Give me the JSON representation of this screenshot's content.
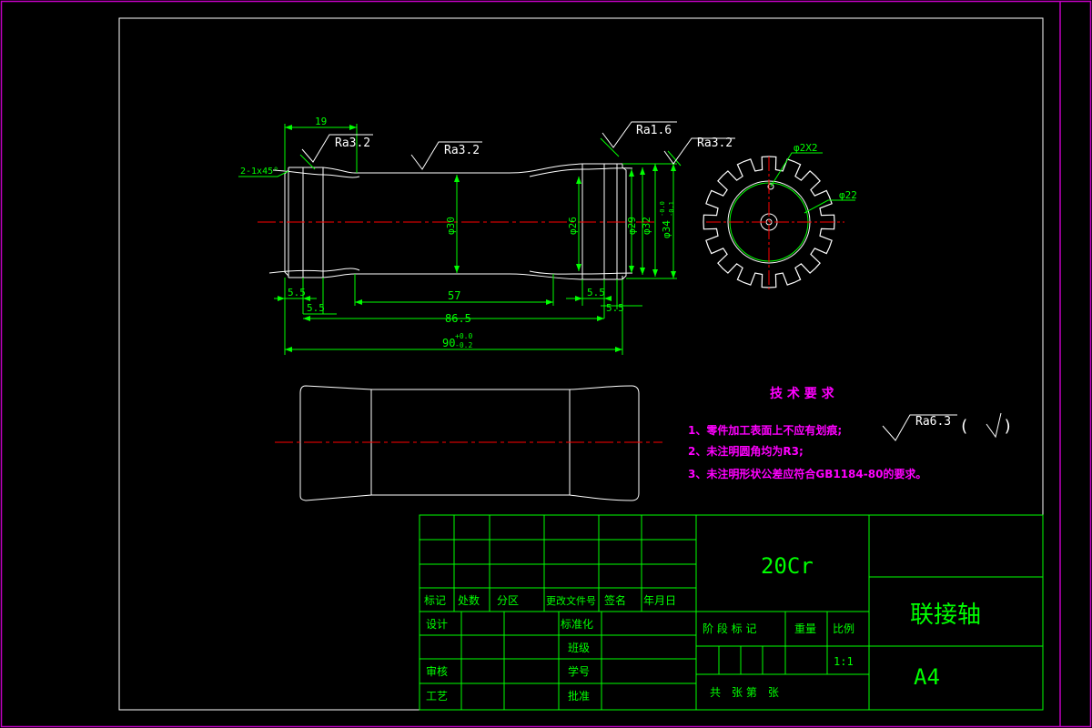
{
  "colors": {
    "background": "#000000",
    "border_outer": "#c000c0",
    "border_inner": "#ffffff",
    "geometry": "#ffffff",
    "dimension": "#00ff00",
    "centerline": "#ff0000",
    "note_text": "#ff00ff",
    "title_block": "#00ff00"
  },
  "dimensions": {
    "d19": "19",
    "d2x45": "2-1x45°",
    "d5_5a": "5.5",
    "d5_5b": "5.5",
    "d5_5c": "5.5",
    "d5_5d": "5.5",
    "d57": "57",
    "d86_5": "86.5",
    "d90": "90",
    "d90_tol_upper": "+0.0",
    "d90_tol_lower": "-0.2",
    "phi30": "φ30",
    "phi26": "φ26",
    "phi29": "φ29",
    "phi32": "φ32",
    "phi34": "φ34",
    "phi34_tol_upper": "-0.0",
    "phi34_tol_lower": "-0.1",
    "phi2x2": "φ2X2",
    "phi22": "φ22"
  },
  "roughness": {
    "r1": "Ra3.2",
    "r2": "Ra3.2",
    "r3": "Ra1.6",
    "r4": "Ra3.2",
    "general": "Ra6.3",
    "general_paren_open": "(",
    "general_paren_close": ")"
  },
  "notes": {
    "title": "技 术 要 求",
    "items": [
      "1、零件加工表面上不应有划痕;",
      "2、未注明圆角均为R3;",
      "3、未注明形状公差应符合GB1184-80的要求。"
    ]
  },
  "title_block": {
    "material": "20Cr",
    "part_name": "联接轴",
    "sheet_size": "A4",
    "scale": "1:1",
    "hdr_mark": "标记",
    "hdr_count": "处数",
    "hdr_zone": "分区",
    "hdr_doc": "更改文件号",
    "hdr_sign": "签名",
    "hdr_date": "年月日",
    "design": "设计",
    "standard": "标准化",
    "class": "班级",
    "review": "审核",
    "student_id": "学号",
    "process": "工艺",
    "approve": "批准",
    "stage": "阶 段 标 记",
    "weight": "重量",
    "scale_label": "比例",
    "sheets": "共　张 第　张"
  }
}
